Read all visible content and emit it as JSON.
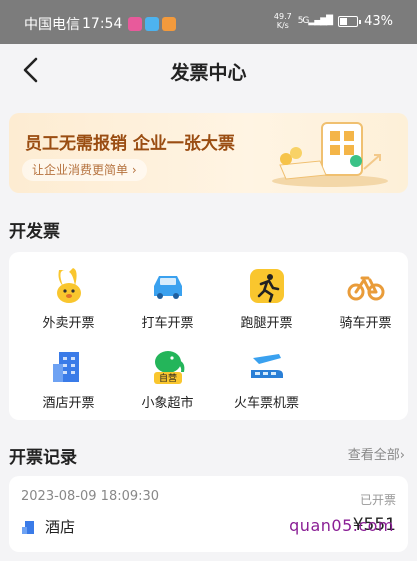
{
  "status_bar": {
    "carrier": "中国电信",
    "time": "17:54",
    "speed_value": "49.7",
    "speed_unit": "K/s",
    "network": "5G",
    "battery": "43%",
    "battery_level": 0.43
  },
  "nav": {
    "title": "发票中心",
    "back_icon": "chevron-left-icon"
  },
  "banner": {
    "title": "员工无需报销 企业一张大票",
    "subtitle": "让企业消费更简单 ›"
  },
  "invoice_section": {
    "title": "开发票",
    "items": [
      {
        "label": "外卖开票",
        "icon": "takeout-rabbit-icon"
      },
      {
        "label": "打车开票",
        "icon": "car-icon"
      },
      {
        "label": "跑腿开票",
        "icon": "runner-icon"
      },
      {
        "label": "骑车开票",
        "icon": "bicycle-icon"
      },
      {
        "label": "酒店开票",
        "icon": "hotel-icon"
      },
      {
        "label": "小象超市",
        "icon": "elephant-icon",
        "badge": "自营"
      },
      {
        "label": "火车票机票",
        "icon": "train-plane-icon"
      }
    ]
  },
  "records": {
    "title": "开票记录",
    "more": "查看全部›",
    "item": {
      "time": "2023-08-09 18:09:30",
      "status": "已开票",
      "name": "酒店",
      "amount": "¥551",
      "watermark": "quan05.com"
    }
  },
  "colors": {
    "banner_title": "#9a4d12",
    "takeout_yellow": "#f9c62e",
    "car_blue": "#3aa1ef",
    "elephant_green": "#24b55a",
    "hotel_blue": "#3a7be8"
  }
}
